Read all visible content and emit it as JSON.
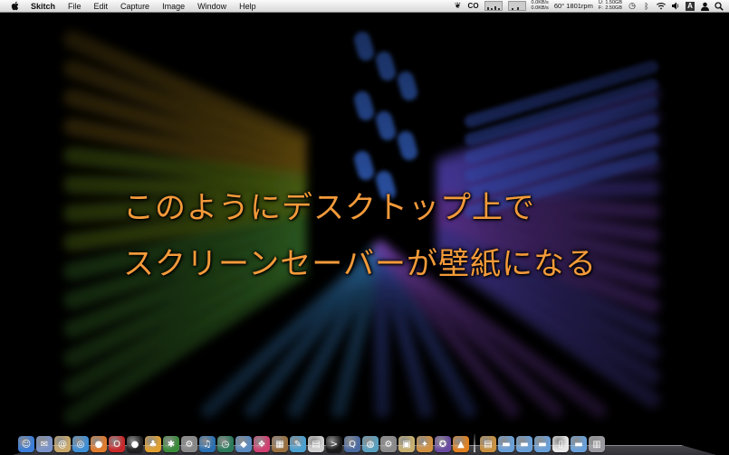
{
  "menubar": {
    "app_name": "Skitch",
    "menus": [
      "File",
      "Edit",
      "Capture",
      "Image",
      "Window",
      "Help"
    ],
    "status": {
      "cpu_label": "CO",
      "net_up": "0.0KB/s",
      "net_down": "0.0KB/s",
      "temp_fan": "60° 1801rpm",
      "mem_u_label": "U:",
      "mem_u": "1.50GB",
      "mem_f_label": "F:",
      "mem_f": "2.50GB",
      "input_label": "A"
    }
  },
  "caption": {
    "line1": "このようにデスクトップ上で",
    "line2": "スクリーンセーバーが壁紙になる"
  },
  "colors": {
    "caption": "#f39a3a",
    "menubar_top": "#fafafa",
    "menubar_bottom": "#d8d8d8"
  },
  "dock": {
    "icons": [
      {
        "name": "finder-icon",
        "color": "#3b7dd8",
        "glyph": "☺"
      },
      {
        "name": "mail-icon",
        "color": "#7a93c8",
        "glyph": "✉"
      },
      {
        "name": "contacts-icon",
        "color": "#c9a86a",
        "glyph": "@"
      },
      {
        "name": "safari-icon",
        "color": "#3f8fd6",
        "glyph": "◎"
      },
      {
        "name": "firefox-icon",
        "color": "#e07a2c",
        "glyph": "●"
      },
      {
        "name": "opera-icon",
        "color": "#c8282a",
        "glyph": "O"
      },
      {
        "name": "ball-app-icon",
        "color": "#222222",
        "glyph": "●"
      },
      {
        "name": "adium-icon",
        "color": "#e0a030",
        "glyph": "♣"
      },
      {
        "name": "x-app-icon",
        "color": "#3a8a3a",
        "glyph": "✱"
      },
      {
        "name": "utility-icon",
        "color": "#888888",
        "glyph": "⚙"
      },
      {
        "name": "itunes-icon",
        "color": "#2a6fb0",
        "glyph": "♫"
      },
      {
        "name": "time-machine-icon",
        "color": "#2a7a5a",
        "glyph": "◷"
      },
      {
        "name": "box-app-icon",
        "color": "#5a8ac0",
        "glyph": "◆"
      },
      {
        "name": "gift-app-icon",
        "color": "#d04070",
        "glyph": "❖"
      },
      {
        "name": "photo-app-icon",
        "color": "#9a7040",
        "glyph": "▦"
      },
      {
        "name": "pen-app-icon",
        "color": "#4aa0d0",
        "glyph": "✎"
      },
      {
        "name": "notes-app-icon",
        "color": "#d0d0d0",
        "glyph": "▤"
      },
      {
        "name": "terminal-icon",
        "color": "#1a1a1a",
        "glyph": ">"
      },
      {
        "name": "quicktime-icon",
        "color": "#4a6aa0",
        "glyph": "Q"
      },
      {
        "name": "network-app-icon",
        "color": "#5aa0c0",
        "glyph": "◍"
      },
      {
        "name": "system-preferences-icon",
        "color": "#8a8a8a",
        "glyph": "⚙"
      },
      {
        "name": "folder-app-icon",
        "color": "#c8b070",
        "glyph": "▣"
      },
      {
        "name": "lion-app-icon",
        "color": "#d09040",
        "glyph": "✦"
      },
      {
        "name": "ninja-app-icon",
        "color": "#6a4aa0",
        "glyph": "✪"
      },
      {
        "name": "vlc-icon",
        "color": "#e08020",
        "glyph": "▲"
      }
    ],
    "stacks": [
      {
        "name": "app-stack-icon",
        "color": "#c89040",
        "glyph": "▤"
      },
      {
        "name": "folder-stack-icon",
        "color": "#6aa0d8",
        "glyph": "▬"
      },
      {
        "name": "documents-stack-icon",
        "color": "#6aa0d8",
        "glyph": "▬"
      },
      {
        "name": "downloads-stack-icon",
        "color": "#6aa0d8",
        "glyph": "▬"
      },
      {
        "name": "file-stack-icon",
        "color": "#e8e8e8",
        "glyph": "▯"
      },
      {
        "name": "folder-stack-2-icon",
        "color": "#6aa0d8",
        "glyph": "▬"
      },
      {
        "name": "trash-icon",
        "color": "#9a9aa0",
        "glyph": "▥"
      }
    ]
  }
}
